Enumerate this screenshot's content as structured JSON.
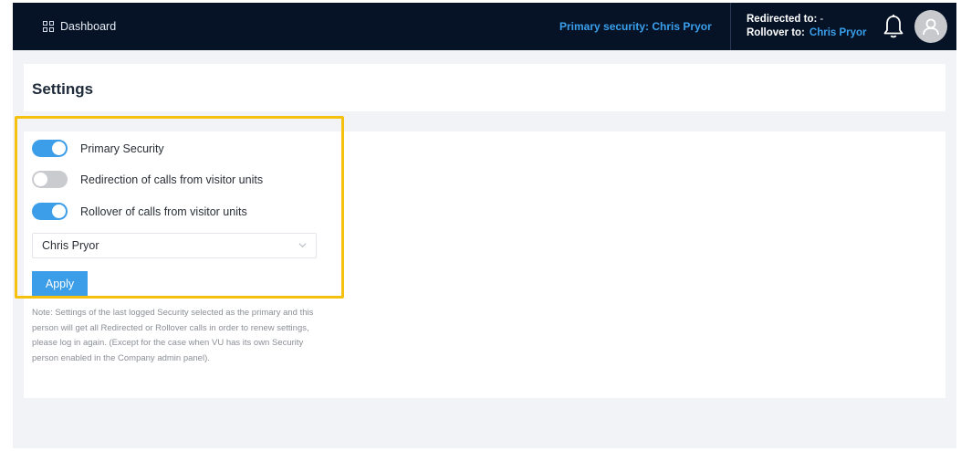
{
  "header": {
    "nav_label": "Dashboard",
    "primary_security": "Primary security: Chris Pryor",
    "redirected_label": "Redirected to:",
    "redirected_value": "-",
    "rollover_label": "Rollover to:",
    "rollover_value": "Chris Pryor",
    "icons": [
      "dashboard-grid-icon",
      "bell-icon",
      "user-avatar-icon"
    ]
  },
  "page": {
    "title": "Settings"
  },
  "form": {
    "toggles": [
      {
        "label": "Primary Security",
        "on": true
      },
      {
        "label": "Redirection of calls from visitor units",
        "on": false
      },
      {
        "label": "Rollover of calls from visitor units",
        "on": true
      }
    ],
    "select_value": "Chris Pryor",
    "apply_label": "Apply",
    "note": "Note: Settings of the last logged Security selected as the primary and this person will get all Redirected or Rollover calls in order to renew settings, please log in again. (Except for the case when VU has its own Security person enabled in the Company admin panel)."
  },
  "colors": {
    "header_bg": "#061327",
    "accent": "#3c9ee8",
    "highlight": "#f6c10e",
    "toggle_off": "#c9cbcf"
  }
}
